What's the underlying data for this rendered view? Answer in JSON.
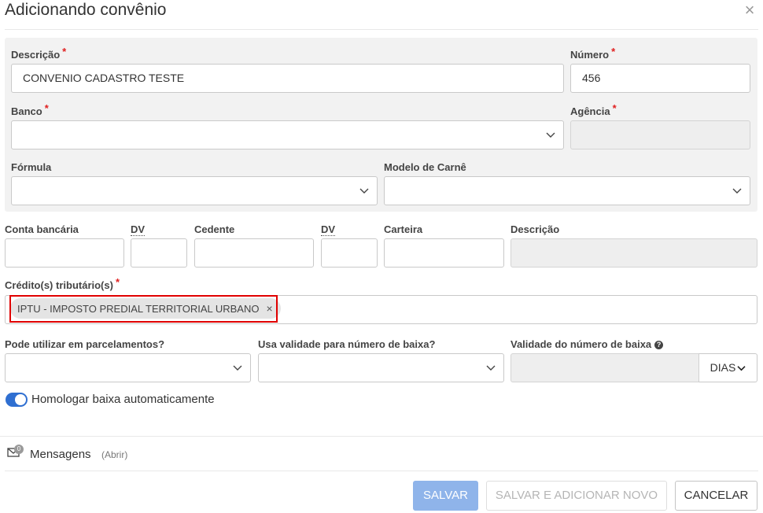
{
  "dialog": {
    "title": "Adicionando convênio"
  },
  "general": {
    "descricao_label": "Descrição",
    "descricao_value": "CONVENIO CADASTRO TESTE",
    "numero_label": "Número",
    "numero_value": "456",
    "banco_label": "Banco",
    "banco_value": "",
    "agencia_label": "Agência",
    "agencia_value": "",
    "formula_label": "Fórmula",
    "formula_value": "",
    "modelo_label": "Modelo de Carnê",
    "modelo_value": ""
  },
  "account": {
    "conta_label": "Conta bancária",
    "dv1_label": "DV",
    "cedente_label": "Cedente",
    "dv2_label": "DV",
    "carteira_label": "Carteira",
    "descricao_label": "Descrição"
  },
  "creditos": {
    "label": "Crédito(s) tributário(s)",
    "tags": [
      "IPTU - IMPOSTO PREDIAL TERRITORIAL URBANO"
    ]
  },
  "options": {
    "parcelamentos_label": "Pode utilizar em parcelamentos?",
    "validade_baixa_label": "Usa validade para número de baixa?",
    "validade_numero_label": "Validade do número de baixa",
    "unit_value": "DIAS",
    "homologar_label": "Homologar baixa automaticamente",
    "homologar_on": true
  },
  "messages": {
    "label": "Mensagens",
    "open_label": "(Abrir)",
    "count": "0"
  },
  "footer": {
    "save_label": "SALVAR",
    "save_new_label": "SALVAR E ADICIONAR NOVO",
    "cancel_label": "CANCELAR"
  },
  "icons": {
    "close": "close-icon",
    "chevron": "chevron-down-icon",
    "help": "question-circle-icon",
    "envelope": "envelope-icon"
  },
  "colors": {
    "primary": "#2f6fd1",
    "primary_disabled": "#8fb4ea",
    "required": "#e02020",
    "highlight": "#e00000"
  }
}
